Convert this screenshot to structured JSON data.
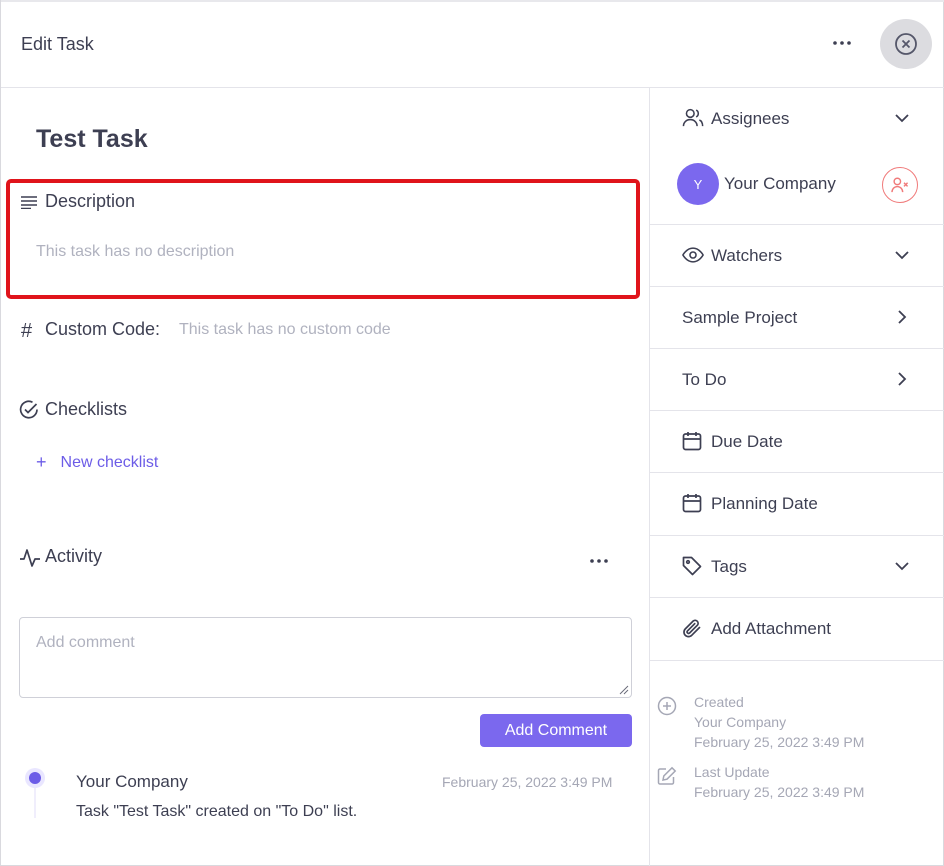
{
  "header": {
    "title": "Edit Task"
  },
  "task": {
    "title": "Test Task"
  },
  "description": {
    "label": "Description",
    "empty_text": "This task has no description"
  },
  "custom_code": {
    "label": "Custom Code:",
    "empty_text": "This task has no custom code"
  },
  "checklists": {
    "label": "Checklists",
    "new_label": "New checklist",
    "plus": "+"
  },
  "activity": {
    "label": "Activity",
    "comment_placeholder": "Add comment",
    "add_comment_label": "Add Comment",
    "entries": [
      {
        "user": "Your Company",
        "time": "February 25, 2022 3:49 PM",
        "text": "Task \"Test Task\" created on \"To Do\" list."
      }
    ]
  },
  "sidebar": {
    "assignees_label": "Assignees",
    "assignee": {
      "initial": "Y",
      "name": "Your Company"
    },
    "watchers_label": "Watchers",
    "project_label": "Sample Project",
    "status_label": "To Do",
    "due_date_label": "Due Date",
    "planning_date_label": "Planning Date",
    "tags_label": "Tags",
    "attachment_label": "Add Attachment",
    "created": {
      "label": "Created",
      "user": "Your Company",
      "time": "February 25, 2022 3:49 PM"
    },
    "updated": {
      "label": "Last Update",
      "time": "February 25, 2022 3:49 PM"
    }
  },
  "colors": {
    "accent": "#7b68ee",
    "highlight": "#e0141b",
    "remove": "#f07a7a"
  }
}
